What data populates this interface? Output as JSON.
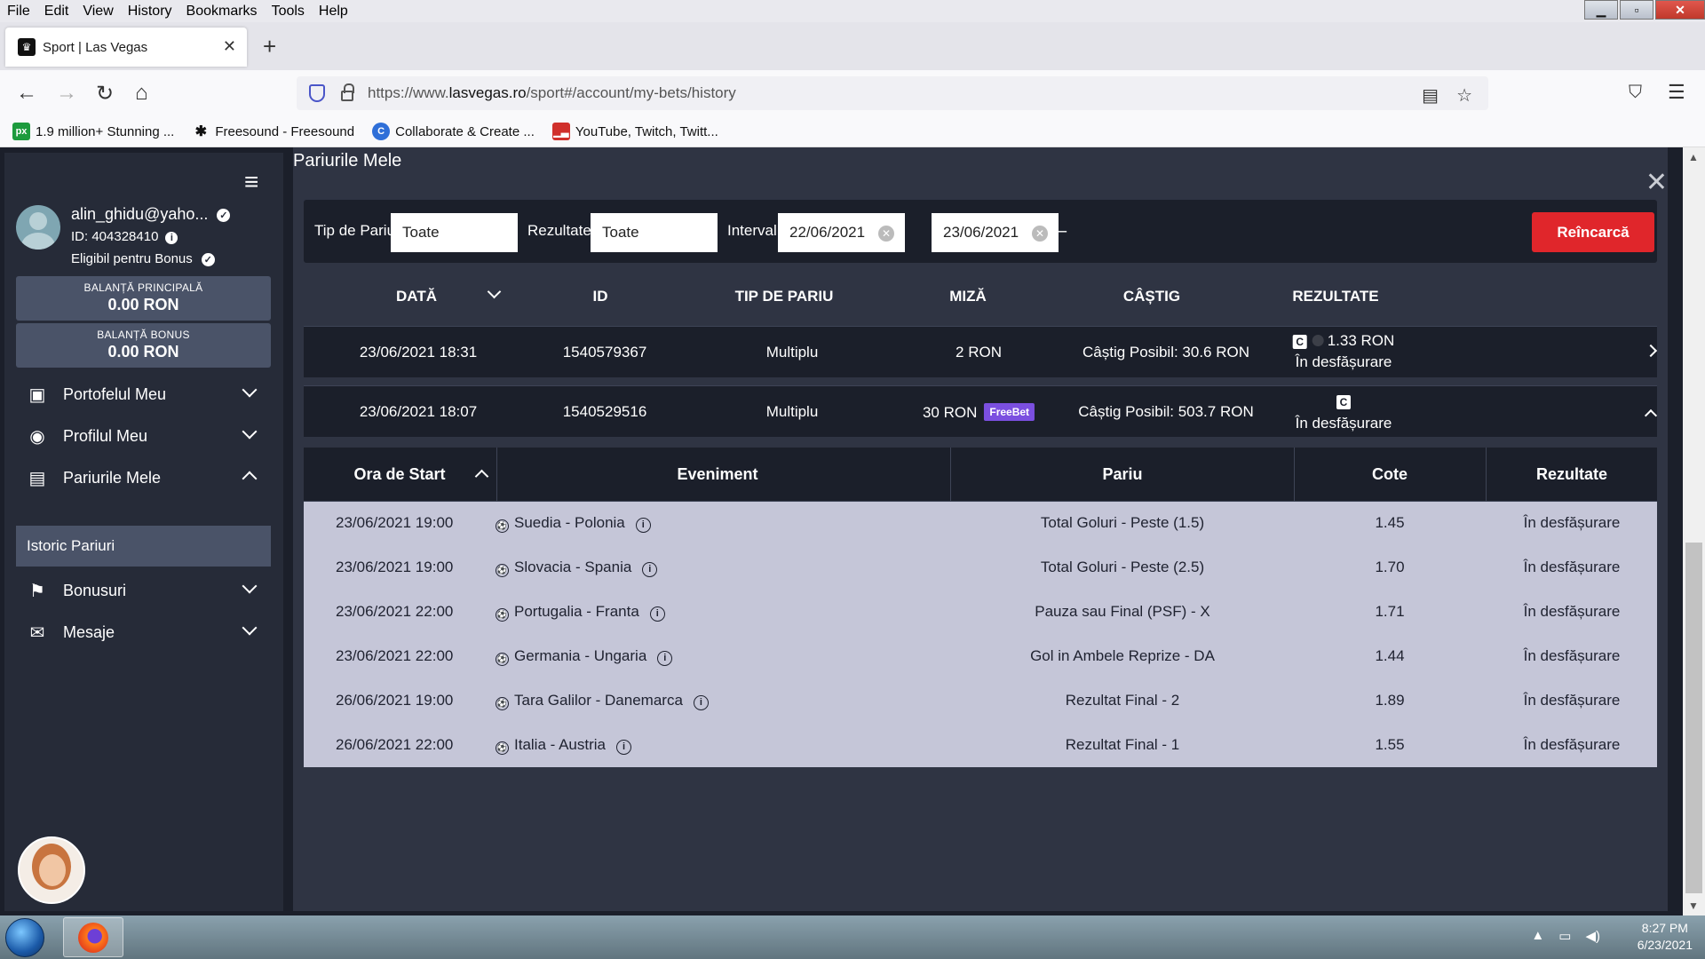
{
  "browser": {
    "menu": [
      "File",
      "Edit",
      "View",
      "History",
      "Bookmarks",
      "Tools",
      "Help"
    ],
    "tab_title": "Sport | Las Vegas",
    "url_prefix": "https://www.",
    "url_host": "lasvegas.ro",
    "url_path": "/sport#/account/my-bets/history",
    "bookmarks": [
      {
        "label": "1.9 million+ Stunning ...",
        "icon": "px-icon",
        "color": "#1d9b3d"
      },
      {
        "label": "Freesound - Freesound",
        "icon": "freesound-icon",
        "color": "#111111"
      },
      {
        "label": "Collaborate & Create ...",
        "icon": "c-icon",
        "color": "#2f6fd8"
      },
      {
        "label": "YouTube, Twitch, Twitt...",
        "icon": "bars-icon",
        "color": "#d0302b"
      }
    ]
  },
  "sidebar": {
    "email": "alin_ghidu@yaho...",
    "user_id": "ID: 404328410",
    "bonus_eligible": "Eligibil pentru Bonus",
    "balance_main_label": "BALANȚĂ PRINCIPALĂ",
    "balance_main_value": "0.00 RON",
    "balance_bonus_label": "BALANȚĂ BONUS",
    "balance_bonus_value": "0.00 RON",
    "menu": [
      {
        "label": "Portofelul Meu",
        "icon": "wallet-icon"
      },
      {
        "label": "Profilul Meu",
        "icon": "user-icon"
      },
      {
        "label": "Pariurile Mele",
        "icon": "clipboard-icon"
      },
      {
        "label": "Bonusuri",
        "icon": "gift-icon"
      },
      {
        "label": "Mesaje",
        "icon": "envelope-icon"
      }
    ],
    "submenu_active": "Istoric Pariuri"
  },
  "main": {
    "title": "Pariurile Mele",
    "filters": {
      "bet_type_label": "Tip de Pariu:",
      "bet_type_value": "Toate",
      "results_label": "Rezultate:",
      "results_value": "Toate",
      "interval_label": "Interval:",
      "date_from": "22/06/2021",
      "date_to": "23/06/2021",
      "dash": "–",
      "reload": "Reîncarcă"
    },
    "columns": [
      "DATĂ",
      "ID",
      "TIP DE PARIU",
      "MIZĂ",
      "CÂȘTIG",
      "REZULTATE"
    ],
    "bets": [
      {
        "date": "23/06/2021 18:31",
        "id": "1540579367",
        "type": "Multiplu",
        "stake": "2 RON",
        "freebet": "",
        "win": "Câștig Posibil: 30.6 RON",
        "cashout": "1.33 RON",
        "status": "În desfășurare"
      },
      {
        "date": "23/06/2021 18:07",
        "id": "1540529516",
        "type": "Multiplu",
        "stake": "30 RON",
        "freebet": "FreeBet",
        "win": "Câștig Posibil: 503.7 RON",
        "cashout": "",
        "status": "În desfășurare"
      }
    ],
    "detail_columns": [
      "Ora de Start",
      "Eveniment",
      "Pariu",
      "Cote",
      "Rezultate"
    ],
    "selections": [
      {
        "start": "23/06/2021 19:00",
        "event": "Suedia - Polonia",
        "bet": "Total Goluri - Peste (1.5)",
        "odds": "1.45",
        "result": "În desfășurare"
      },
      {
        "start": "23/06/2021 19:00",
        "event": "Slovacia - Spania",
        "bet": "Total Goluri - Peste (2.5)",
        "odds": "1.70",
        "result": "În desfășurare"
      },
      {
        "start": "23/06/2021 22:00",
        "event": "Portugalia - Franta",
        "bet": "Pauza sau Final (PSF) - X",
        "odds": "1.71",
        "result": "În desfășurare"
      },
      {
        "start": "23/06/2021 22:00",
        "event": "Germania - Ungaria",
        "bet": "Gol in Ambele Reprize - DA",
        "odds": "1.44",
        "result": "În desfășurare"
      },
      {
        "start": "26/06/2021 19:00",
        "event": "Tara Galilor - Danemarca",
        "bet": "Rezultat Final - 2",
        "odds": "1.89",
        "result": "În desfășurare"
      },
      {
        "start": "26/06/2021 22:00",
        "event": "Italia - Austria",
        "bet": "Rezultat Final - 1",
        "odds": "1.55",
        "result": "În desfășurare"
      }
    ]
  },
  "taskbar": {
    "time": "8:27 PM",
    "date": "6/23/2021"
  }
}
